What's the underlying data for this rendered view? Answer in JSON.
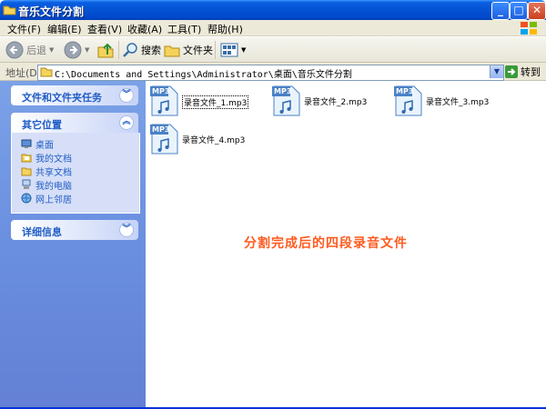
{
  "window": {
    "title": "音乐文件分割",
    "controls": {
      "minimize": "_",
      "maximize": "□",
      "close": "✕"
    }
  },
  "menu": [
    {
      "label": "文件(F)"
    },
    {
      "label": "编辑(E)"
    },
    {
      "label": "查看(V)"
    },
    {
      "label": "收藏(A)"
    },
    {
      "label": "工具(T)"
    },
    {
      "label": "帮助(H)"
    }
  ],
  "toolbar": {
    "back_label": "后退",
    "search_label": "搜索",
    "folders_label": "文件夹"
  },
  "address": {
    "label": "地址(D)",
    "value": "C:\\Documents and Settings\\Administrator\\桌面\\音乐文件分割",
    "go_label": "转到"
  },
  "taskpane": {
    "file_tasks_title": "文件和文件夹任务",
    "other_places_title": "其它位置",
    "other_places": [
      {
        "label": "桌面",
        "icon": "desktop-icon"
      },
      {
        "label": "我的文档",
        "icon": "my-documents-icon"
      },
      {
        "label": "共享文档",
        "icon": "shared-documents-icon"
      },
      {
        "label": "我的电脑",
        "icon": "my-computer-icon"
      },
      {
        "label": "网上邻居",
        "icon": "network-places-icon"
      }
    ],
    "details_title": "详细信息"
  },
  "files": [
    {
      "name": "录音文件_1.mp3",
      "badge": "MP3",
      "selected": true
    },
    {
      "name": "录音文件_2.mp3",
      "badge": "MP3",
      "selected": false
    },
    {
      "name": "录音文件_3.mp3",
      "badge": "MP3",
      "selected": false
    },
    {
      "name": "录音文件_4.mp3",
      "badge": "MP3",
      "selected": false
    }
  ],
  "caption": "分割完成后的四段录音文件",
  "colors": {
    "titlebar": "#0552d4",
    "taskpane": "#6a8fe0",
    "panel_title": "#215dc6",
    "caption": "#ff5a1f"
  }
}
